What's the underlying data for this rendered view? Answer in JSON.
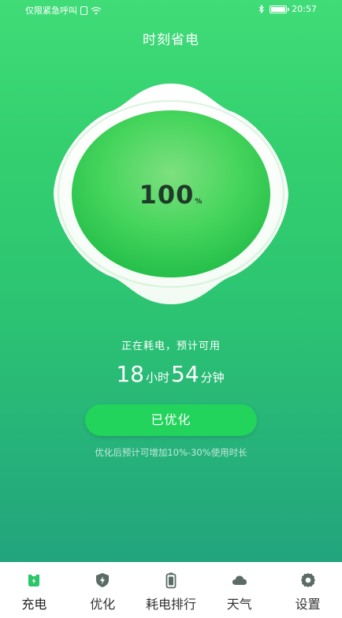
{
  "status_bar": {
    "left_text": "仅限紧急呼叫",
    "time": "20:57",
    "battery_level": 1.0,
    "icons": [
      "sim-icon",
      "wifi-icon",
      "bluetooth-icon",
      "battery-icon"
    ]
  },
  "header": {
    "title": "时刻省电"
  },
  "gauge": {
    "value": "100",
    "unit": "%",
    "level": 1.0
  },
  "usage": {
    "status": "正在耗电，预计可用",
    "hours": "18",
    "hours_unit": "小时",
    "minutes": "54",
    "minutes_unit": "分钟"
  },
  "optimize": {
    "button_label": "已优化",
    "hint": "优化后预计可增加10%-30%使用时长"
  },
  "nav": {
    "items": [
      {
        "label": "充电",
        "icon": "charge-icon",
        "active": true
      },
      {
        "label": "优化",
        "icon": "shield-bolt-icon",
        "active": false
      },
      {
        "label": "耗电排行",
        "icon": "battery-icon",
        "active": false
      },
      {
        "label": "天气",
        "icon": "cloud-icon",
        "active": false
      },
      {
        "label": "设置",
        "icon": "gear-icon",
        "active": false
      }
    ]
  },
  "colors": {
    "bg_top": "#3fdc78",
    "bg_bottom": "#22a47d",
    "button": "#22d35c",
    "nav_active_icon": "#2bc56a",
    "nav_icon": "#5b6b66"
  }
}
